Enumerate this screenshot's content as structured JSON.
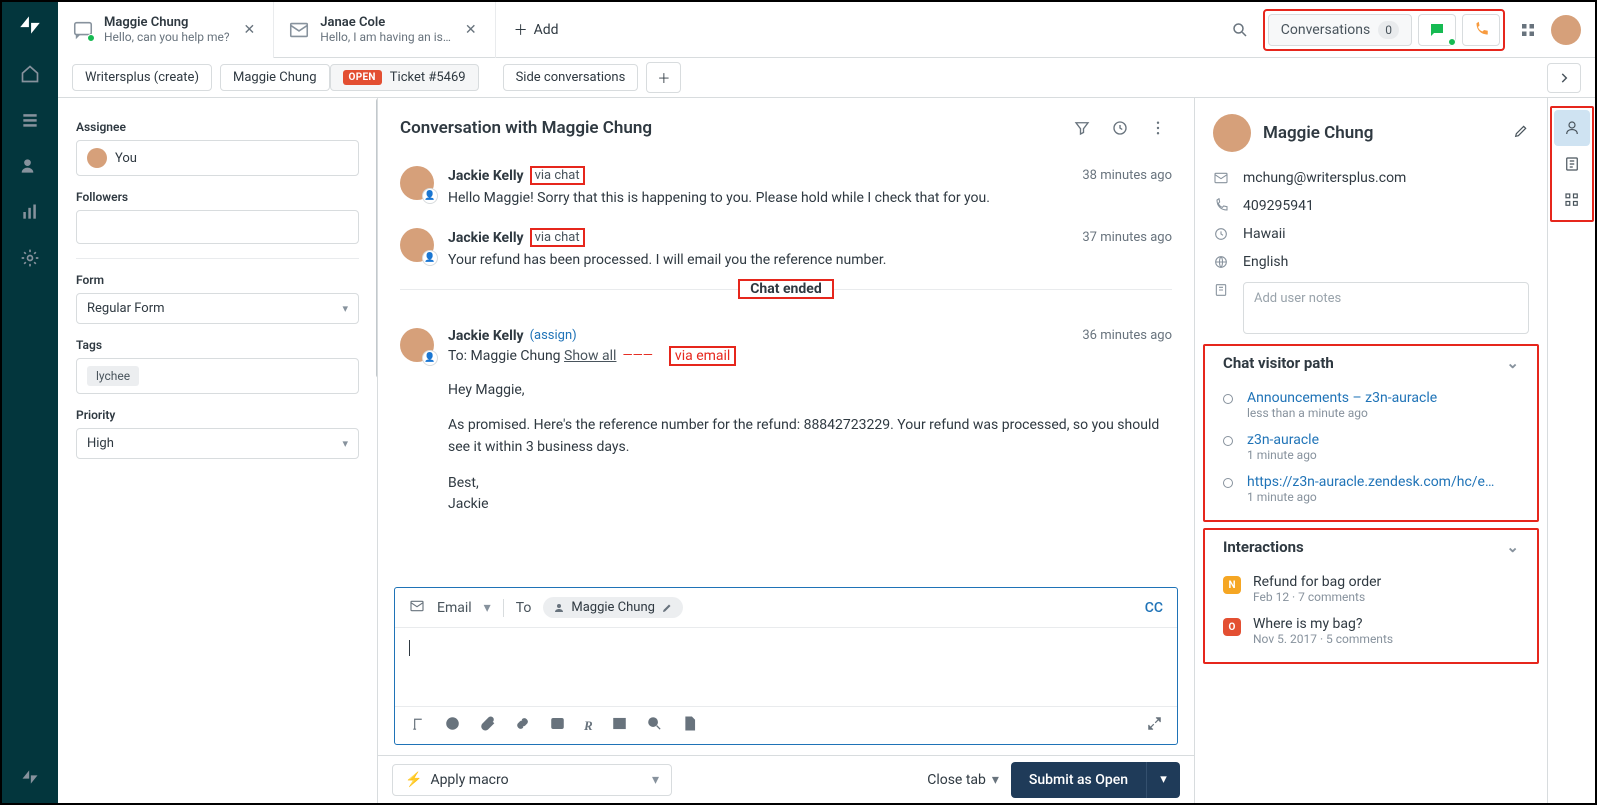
{
  "tabs": [
    {
      "title": "Maggie Chung",
      "subtitle": "Hello, can you help me?",
      "icon": "chat"
    },
    {
      "title": "Janae Cole",
      "subtitle": "Hello, I am having an is…",
      "icon": "mail"
    }
  ],
  "addTab": "Add",
  "toprow": {
    "conversations": "Conversations",
    "conv_count": "0"
  },
  "breadcrumb": {
    "org": "Writersplus (create)",
    "person": "Maggie Chung",
    "open": "OPEN",
    "ticket": "Ticket #5469",
    "side": "Side conversations"
  },
  "props": {
    "assignee_label": "Assignee",
    "assignee_value": "You",
    "followers_label": "Followers",
    "form_label": "Form",
    "form_value": "Regular Form",
    "tags_label": "Tags",
    "tag": "lychee",
    "priority_label": "Priority",
    "priority_value": "High"
  },
  "conversation": {
    "title": "Conversation with Maggie Chung",
    "messages": [
      {
        "name": "Jackie Kelly",
        "via": "via chat",
        "time": "38 minutes ago",
        "body": "Hello Maggie! Sorry that this is happening to you. Please hold while I check that for you."
      },
      {
        "name": "Jackie Kelly",
        "via": "via chat",
        "time": "37 minutes ago",
        "body": "Your refund has been processed. I will email you the reference number."
      }
    ],
    "ended": "Chat ended",
    "email_msg": {
      "name": "Jackie Kelly",
      "assign": "(assign)",
      "time": "36 minutes ago",
      "to_label": "To:",
      "to_name": "Maggie Chung",
      "show_all": "Show all",
      "via_email": "via email",
      "greeting": "Hey Maggie,",
      "body": "As promised. Here's the reference number for the refund: 88842723229. Your refund was processed, so you should see it within 3 business days.",
      "sign1": "Best,",
      "sign2": "Jackie"
    }
  },
  "compose": {
    "channel": "Email",
    "to_label": "To",
    "recipient": "Maggie Chung",
    "cc": "CC"
  },
  "customer": {
    "name": "Maggie Chung",
    "email": "mchung@writersplus.com",
    "phone": "409295941",
    "location": "Hawaii",
    "language": "English",
    "notes_placeholder": "Add user notes"
  },
  "visitor_path": {
    "heading": "Chat visitor path",
    "items": [
      {
        "title": "Announcements – z3n-auracle",
        "meta": "less than a minute ago"
      },
      {
        "title": "z3n-auracle",
        "meta": "1 minute ago"
      },
      {
        "title": "https://z3n-auracle.zendesk.com/hc/en…",
        "meta": "1 minute ago"
      }
    ]
  },
  "interactions": {
    "heading": "Interactions",
    "items": [
      {
        "badge": "N",
        "title": "Refund for bag order",
        "meta": "Feb 12 · 7 comments"
      },
      {
        "badge": "O",
        "title": "Where is my bag?",
        "meta": "Nov 5. 2017 · 5 comments"
      }
    ]
  },
  "footer": {
    "macro": "Apply macro",
    "close": "Close tab",
    "submit": "Submit as Open"
  }
}
